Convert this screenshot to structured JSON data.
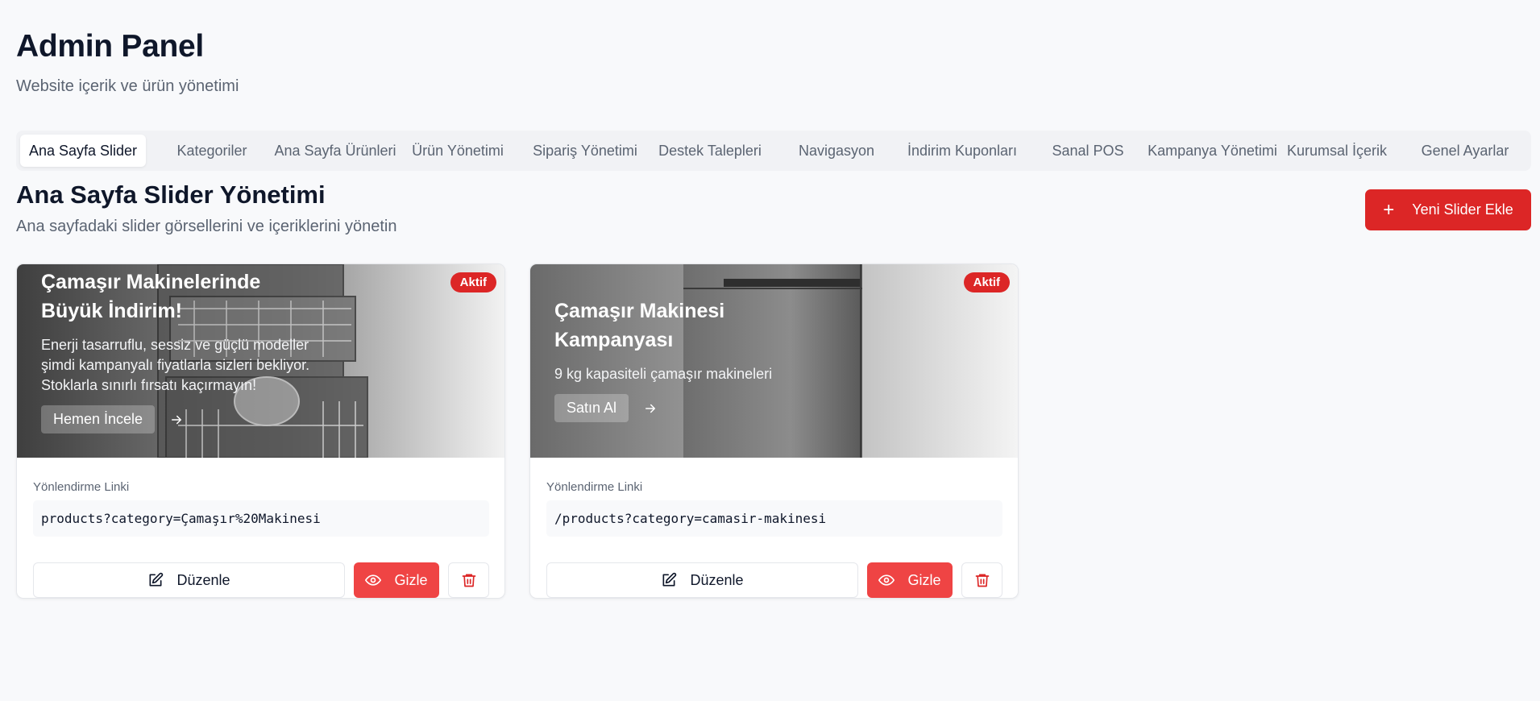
{
  "page": {
    "title": "Admin Panel",
    "subtitle": "Website içerik ve ürün yönetimi"
  },
  "tabs": [
    {
      "label": "Ana Sayfa Slider",
      "active": true
    },
    {
      "label": "Kategoriler"
    },
    {
      "label": "Ana Sayfa Ürünleri"
    },
    {
      "label": "Ürün Yönetimi"
    },
    {
      "label": "Sipariş Yönetimi"
    },
    {
      "label": "Destek Talepleri"
    },
    {
      "label": "Navigasyon"
    },
    {
      "label": "İndirim Kuponları"
    },
    {
      "label": "Sanal POS"
    },
    {
      "label": "Kampanya Yönetimi"
    },
    {
      "label": "Kurumsal İçerik"
    },
    {
      "label": "Genel Ayarlar"
    }
  ],
  "section": {
    "title": "Ana Sayfa Slider Yönetimi",
    "subtitle": "Ana sayfadaki slider görsellerini ve içeriklerini yönetin",
    "add_button": "Yeni Slider Ekle"
  },
  "sliders": [
    {
      "badge": "Aktif",
      "title_line1": "Çamaşır Makinelerinde",
      "title_line2": "Büyük İndirim!",
      "description": "Enerji tasarruflu, sessiz ve güçlü modeller şimdi kampanyalı fiyatlarla sizleri bekliyor. Stoklarla sınırlı fırsatı kaçırmayın!",
      "cta": "Hemen İncele",
      "link_label": "Yönlendirme Linki",
      "link": "products?category=Çamaşır%20Makinesi",
      "edit_label": "Düzenle",
      "hide_label": "Gizle"
    },
    {
      "badge": "Aktif",
      "title_line1": "Çamaşır Makinesi",
      "title_line2": "Kampanyası",
      "description": "9 kg kapasiteli çamaşır makineleri",
      "cta": "Satın Al",
      "link_label": "Yönlendirme Linki",
      "link": "/products?category=camasir-makinesi",
      "edit_label": "Düzenle",
      "hide_label": "Gizle"
    }
  ],
  "colors": {
    "accent": "#dc2626",
    "hide_button": "#ef4444",
    "background": "#f8f9fb"
  }
}
